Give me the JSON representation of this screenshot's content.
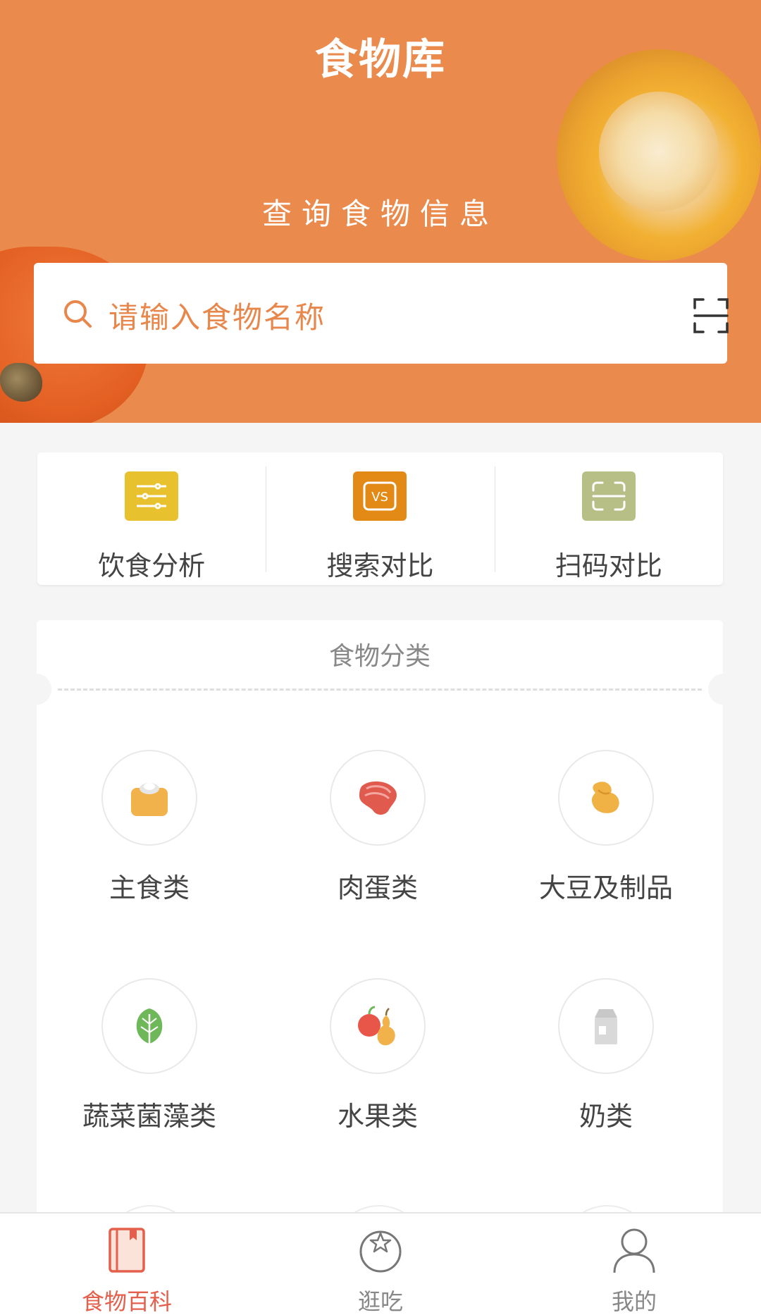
{
  "header": {
    "title": "食物库",
    "subtitle": "查询食物信息",
    "background_color": "#ea8a4c"
  },
  "search": {
    "placeholder": "请输入食物名称",
    "search_icon": "search-icon",
    "scan_icon": "scan-icon"
  },
  "quick_actions": [
    {
      "label": "饮食分析",
      "icon": "sliders-icon",
      "color": "#e8c22e"
    },
    {
      "label": "搜索对比",
      "icon": "vs-icon",
      "color": "#e38a16"
    },
    {
      "label": "扫码对比",
      "icon": "scan-frame-icon",
      "color": "#b8bf86"
    }
  ],
  "categories": {
    "title": "食物分类",
    "items": [
      {
        "label": "主食类",
        "icon": "grain-bag-icon"
      },
      {
        "label": "肉蛋类",
        "icon": "steak-icon"
      },
      {
        "label": "大豆及制品",
        "icon": "soybean-icon"
      },
      {
        "label": "蔬菜菌藻类",
        "icon": "leaf-icon"
      },
      {
        "label": "水果类",
        "icon": "fruit-icon"
      },
      {
        "label": "奶类",
        "icon": "milk-carton-icon"
      }
    ]
  },
  "tabbar": {
    "items": [
      {
        "label": "食物百科",
        "icon": "book-icon",
        "active": true
      },
      {
        "label": "逛吃",
        "icon": "explore-icon",
        "active": false
      },
      {
        "label": "我的",
        "icon": "user-icon",
        "active": false
      }
    ],
    "active_color": "#e4604c"
  }
}
